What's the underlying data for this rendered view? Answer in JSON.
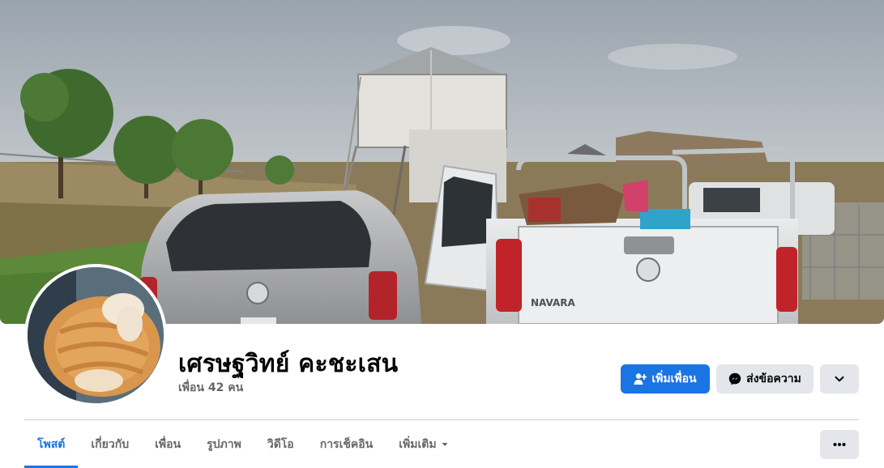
{
  "profile": {
    "name": "เศรษฐวิทย์ คะชะเสน",
    "friends_text": "เพื่อน 42 คน"
  },
  "cover_photo": {
    "vehicle_text": "NAVARA"
  },
  "actions": {
    "add_friend_label": "เพิ่มเพื่อน",
    "add_friend_icon": "person-add-icon",
    "message_label": "ส่งข้อความ",
    "message_icon": "messenger-icon",
    "dropdown_icon": "chevron-down-icon",
    "more_icon": "ellipsis-icon"
  },
  "tabs": [
    {
      "label": "โพสต์",
      "active": true
    },
    {
      "label": "เกี่ยวกับ",
      "active": false
    },
    {
      "label": "เพื่อน",
      "active": false
    },
    {
      "label": "รูปภาพ",
      "active": false
    },
    {
      "label": "วิดีโอ",
      "active": false
    },
    {
      "label": "การเช็คอิน",
      "active": false
    },
    {
      "label": "เพิ่มเติม",
      "active": false
    }
  ],
  "colors": {
    "accent": "#1b74e4",
    "secondary_button": "#e4e6eb",
    "muted_text": "#65676b"
  }
}
